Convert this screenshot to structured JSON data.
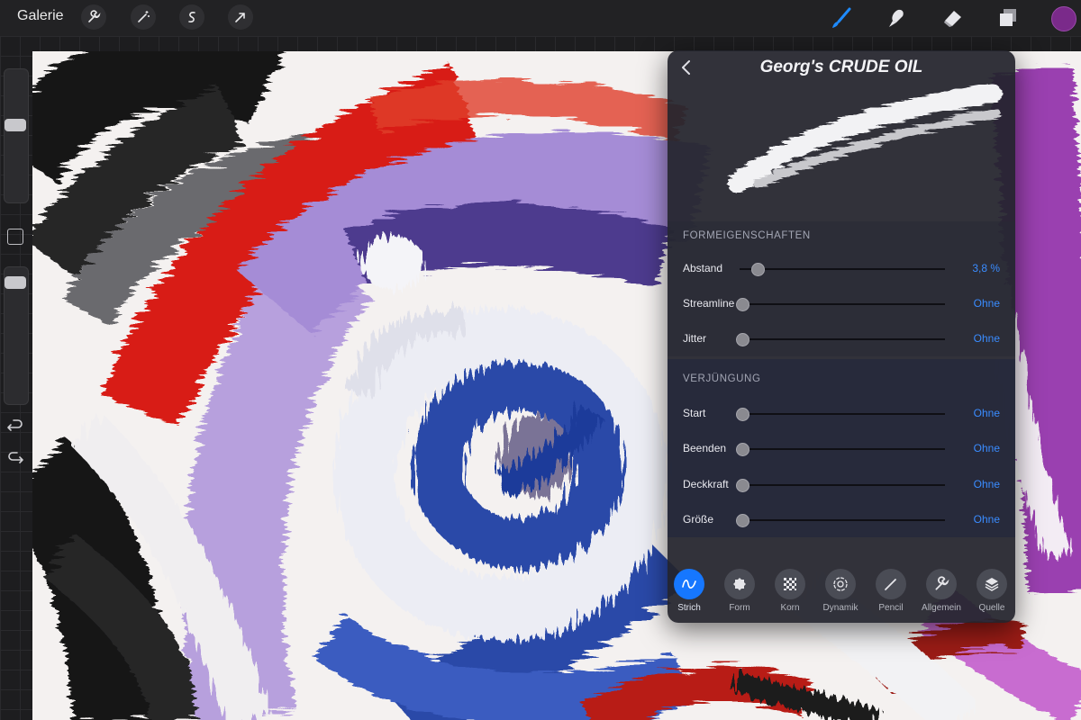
{
  "topbar": {
    "gallery_label": "Galerie",
    "left_tools": [
      "wrench-icon",
      "magic-wand-icon",
      "selection-icon",
      "transform-arrow-icon"
    ],
    "right_tools": [
      "brush-icon",
      "smudge-icon",
      "eraser-icon",
      "layers-icon"
    ],
    "active_tool": "brush-icon",
    "active_color": "#7a2a8a",
    "accent_color": "#1677ff"
  },
  "sidebar": {
    "size_slider_level": 0.42,
    "opacity_slider_level": 0.08,
    "icons": [
      "modify-square-icon",
      "undo-icon",
      "redo-icon"
    ]
  },
  "brush_panel": {
    "title": "Georg's CRUDE OIL",
    "back_icon": "chevron-left-icon",
    "sections": [
      {
        "heading": "FORMEIGENSCHAFTEN",
        "rows": [
          {
            "label": "Abstand",
            "value": "3,8 %",
            "level": 0.05
          },
          {
            "label": "Streamline",
            "value": "Ohne",
            "level": 0
          },
          {
            "label": "Jitter",
            "value": "Ohne",
            "level": 0
          }
        ]
      },
      {
        "heading": "VERJÜNGUNG",
        "rows": [
          {
            "label": "Start",
            "value": "Ohne",
            "level": 0
          },
          {
            "label": "Beenden",
            "value": "Ohne",
            "level": 0
          },
          {
            "label": "Deckkraft",
            "value": "Ohne",
            "level": 0
          },
          {
            "label": "Größe",
            "value": "Ohne",
            "level": 0
          }
        ]
      }
    ],
    "tabs": [
      {
        "label": "Strich",
        "icon": "stroke-wave-icon",
        "active": true
      },
      {
        "label": "Form",
        "icon": "shape-blob-icon",
        "active": false
      },
      {
        "label": "Korn",
        "icon": "grain-checker-icon",
        "active": false
      },
      {
        "label": "Dynamik",
        "icon": "dynamics-swirl-icon",
        "active": false
      },
      {
        "label": "Pencil",
        "icon": "pencil-icon",
        "active": false
      },
      {
        "label": "Allgemein",
        "icon": "wrench-icon",
        "active": false
      },
      {
        "label": "Quelle",
        "icon": "stack-icon",
        "active": false
      }
    ]
  }
}
